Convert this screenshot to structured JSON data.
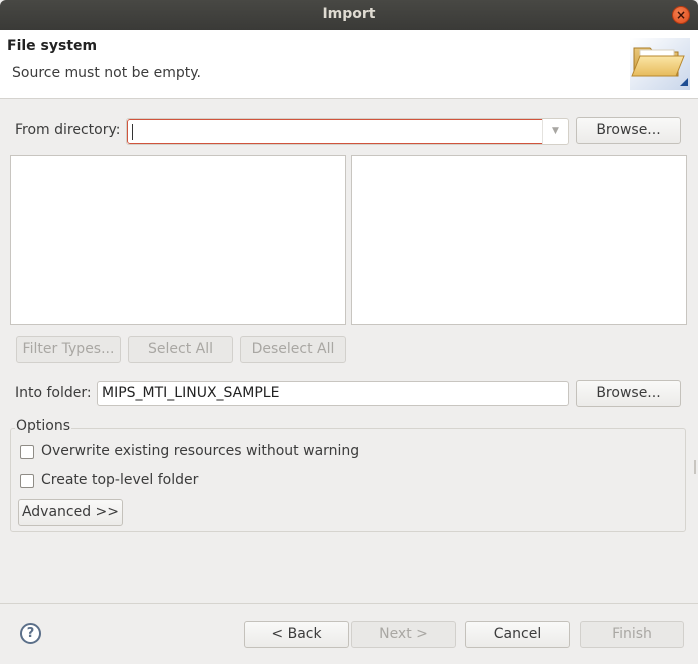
{
  "window": {
    "title": "Import"
  },
  "banner": {
    "heading": "File system",
    "message": "Source must not be empty."
  },
  "from_directory": {
    "label": "From directory:",
    "value": "",
    "browse_label": "Browse..."
  },
  "selection_buttons": {
    "filter_types": "Filter Types...",
    "select_all": "Select All",
    "deselect_all": "Deselect All"
  },
  "into_folder": {
    "label": "Into folder:",
    "value": "MIPS_MTI_LINUX_SAMPLE",
    "browse_label": "Browse..."
  },
  "options": {
    "title": "Options",
    "overwrite_label": "Overwrite existing resources without warning",
    "overwrite_checked": false,
    "create_top_level_label": "Create top-level folder",
    "create_top_level_checked": false,
    "advanced_label": "Advanced >>"
  },
  "footer": {
    "back": "< Back",
    "next": "Next >",
    "cancel": "Cancel",
    "finish": "Finish"
  },
  "colors": {
    "error_border": "#d0543d",
    "accent_orange": "#df4b1c"
  },
  "icons": [
    "close-icon",
    "folder-icon",
    "dropdown-arrow-icon",
    "help-icon"
  ]
}
